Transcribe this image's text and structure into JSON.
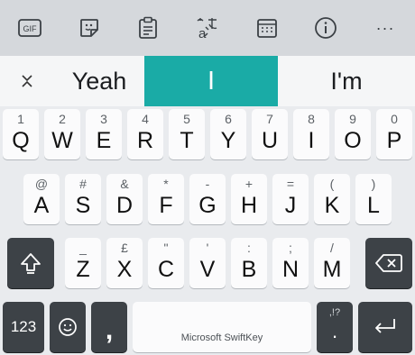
{
  "toolbar": {
    "icons": [
      "gif-icon",
      "sticker-icon",
      "clipboard-icon",
      "translate-icon",
      "calendar-icon",
      "info-icon",
      "more-icon"
    ],
    "gif_label": "GIF",
    "more_label": "···"
  },
  "suggestions": {
    "items": [
      "Yeah",
      "I",
      "I'm"
    ],
    "selected_index": 1
  },
  "rows": {
    "row1": [
      {
        "sec": "1",
        "pri": "Q"
      },
      {
        "sec": "2",
        "pri": "W"
      },
      {
        "sec": "3",
        "pri": "E"
      },
      {
        "sec": "4",
        "pri": "R"
      },
      {
        "sec": "5",
        "pri": "T"
      },
      {
        "sec": "6",
        "pri": "Y"
      },
      {
        "sec": "7",
        "pri": "U"
      },
      {
        "sec": "8",
        "pri": "I"
      },
      {
        "sec": "9",
        "pri": "O"
      },
      {
        "sec": "0",
        "pri": "P"
      }
    ],
    "row2": [
      {
        "sec": "@",
        "pri": "A"
      },
      {
        "sec": "#",
        "pri": "S"
      },
      {
        "sec": "&",
        "pri": "D"
      },
      {
        "sec": "*",
        "pri": "F"
      },
      {
        "sec": "-",
        "pri": "G"
      },
      {
        "sec": "+",
        "pri": "H"
      },
      {
        "sec": "=",
        "pri": "J"
      },
      {
        "sec": "(",
        "pri": "K"
      },
      {
        "sec": ")",
        "pri": "L"
      }
    ],
    "row3": [
      {
        "sec": "_",
        "pri": "Z"
      },
      {
        "sec": "£",
        "pri": "X"
      },
      {
        "sec": "\"",
        "pri": "C"
      },
      {
        "sec": "'",
        "pri": "V"
      },
      {
        "sec": ":",
        "pri": "B"
      },
      {
        "sec": ";",
        "pri": "N"
      },
      {
        "sec": "/",
        "pri": "M"
      }
    ]
  },
  "bottom": {
    "numbers_label": "123",
    "comma_label": ",",
    "space_label": "Microsoft SwiftKey",
    "punct_sec": ",!?",
    "punct_pri": "."
  },
  "colors": {
    "accent": "#1aaba6",
    "dark_key": "#3d4247",
    "light_key": "#fbfbfc",
    "background": "#e9ebee"
  }
}
